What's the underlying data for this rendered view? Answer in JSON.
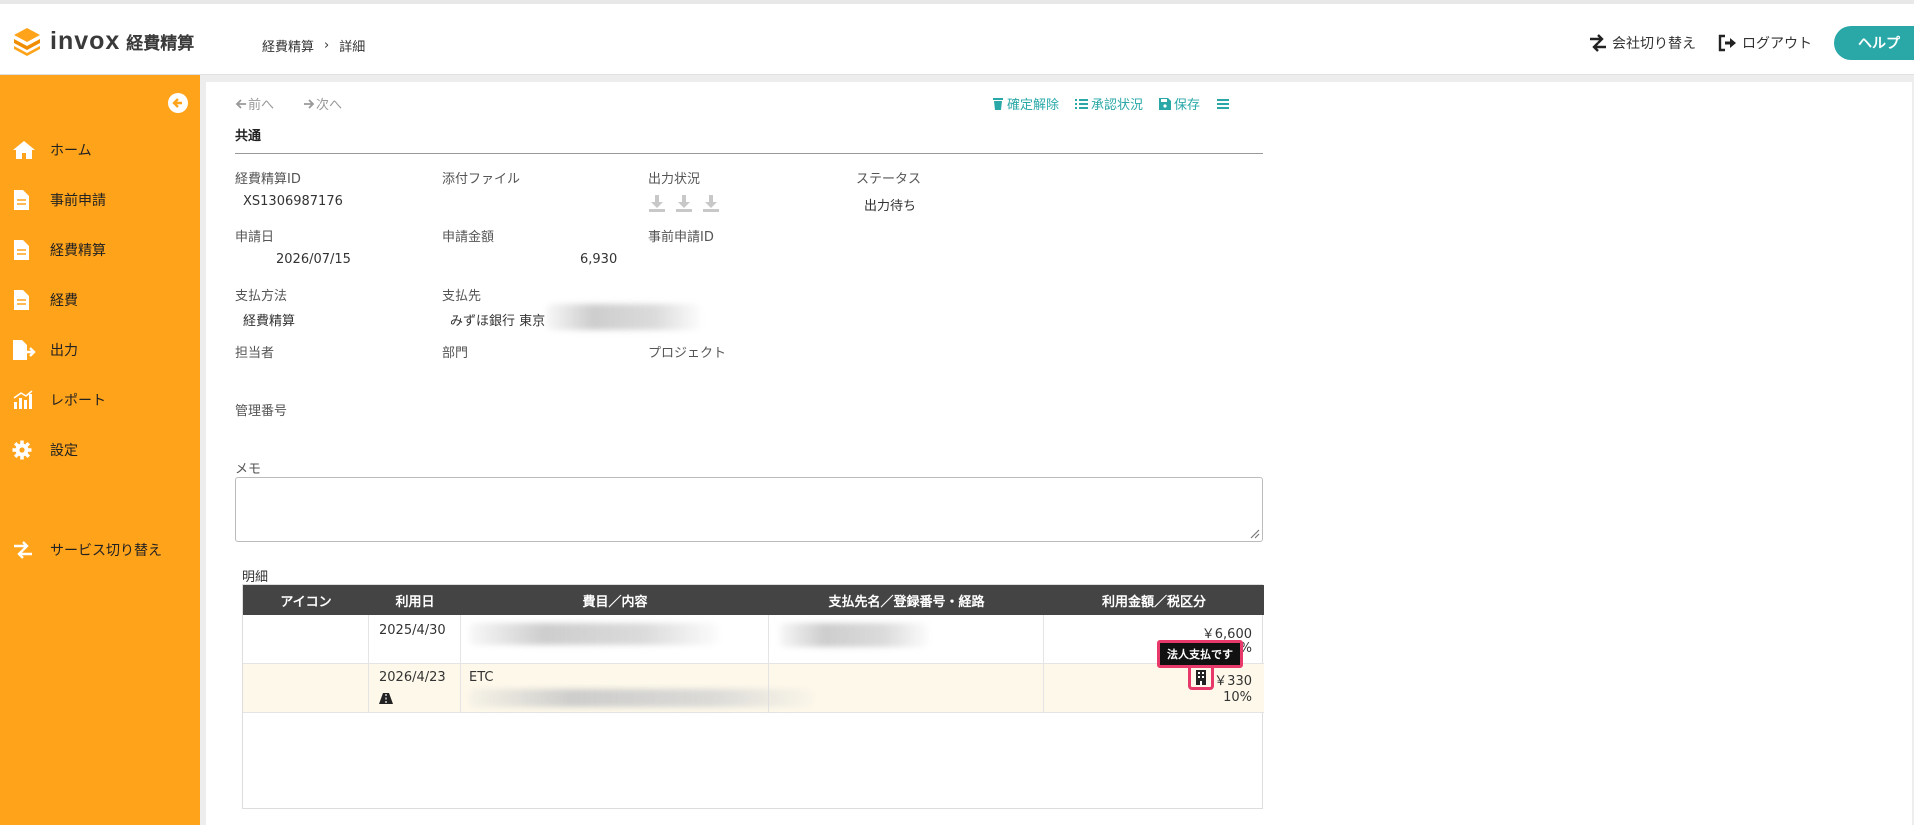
{
  "header": {
    "logo_text": "invox",
    "logo_sub": "経費精算",
    "breadcrumb": [
      "経費精算",
      "詳細"
    ],
    "switch_company": "会社切り替え",
    "logout": "ログアウト",
    "help": "ヘルプ"
  },
  "sidebar": {
    "items": [
      {
        "label": "ホーム",
        "icon": "home-icon"
      },
      {
        "label": "事前申請",
        "icon": "document-icon"
      },
      {
        "label": "経費精算",
        "icon": "document-icon"
      },
      {
        "label": "経費",
        "icon": "document-icon"
      },
      {
        "label": "出力",
        "icon": "export-file-icon"
      },
      {
        "label": "レポート",
        "icon": "chart-icon"
      },
      {
        "label": "設定",
        "icon": "gear-icon"
      },
      {
        "label": "サービス切り替え",
        "icon": "switch-icon"
      }
    ]
  },
  "toolbar": {
    "prev": "前へ",
    "next": "次へ",
    "unconfirm": "確定解除",
    "approval_status": "承認状況",
    "save": "保存"
  },
  "section": {
    "title": "共通"
  },
  "fields": {
    "expense_id_label": "経費精算ID",
    "expense_id_value": "XS1306987176",
    "attachment_label": "添付ファイル",
    "output_status_label": "出力状況",
    "status_label": "ステータス",
    "status_value": "出力待ち",
    "apply_date_label": "申請日",
    "apply_date_value": "2026/07/15",
    "amount_label": "申請金額",
    "amount_value": "6,930",
    "pre_application_id_label": "事前申請ID",
    "payment_method_label": "支払方法",
    "payment_method_value": "経費精算",
    "payee_label": "支払先",
    "payee_value": "みずほ銀行 東京",
    "person_label": "担当者",
    "department_label": "部門",
    "project_label": "プロジェクト",
    "management_no_label": "管理番号",
    "memo_label": "メモ",
    "memo_value": ""
  },
  "details": {
    "title": "明細",
    "columns": [
      "アイコン",
      "利用日",
      "費目／内容",
      "支払先名／登録番号・経路",
      "利用金額／税区分"
    ],
    "rows": [
      {
        "date": "2025/4/30",
        "content": "",
        "payee": "",
        "amount": "￥6,600",
        "tax": "%"
      },
      {
        "date": "2026/4/23",
        "content": "ETC",
        "payee": "",
        "amount": "￥330",
        "tax": "10%",
        "row_icon": "road-icon",
        "amount_icon": "building-icon"
      }
    ],
    "tooltip": "法人支払です"
  },
  "colors": {
    "sidebar": "#ffa31a",
    "accent": "#2aa8a8",
    "highlight": "#e83a6a"
  }
}
